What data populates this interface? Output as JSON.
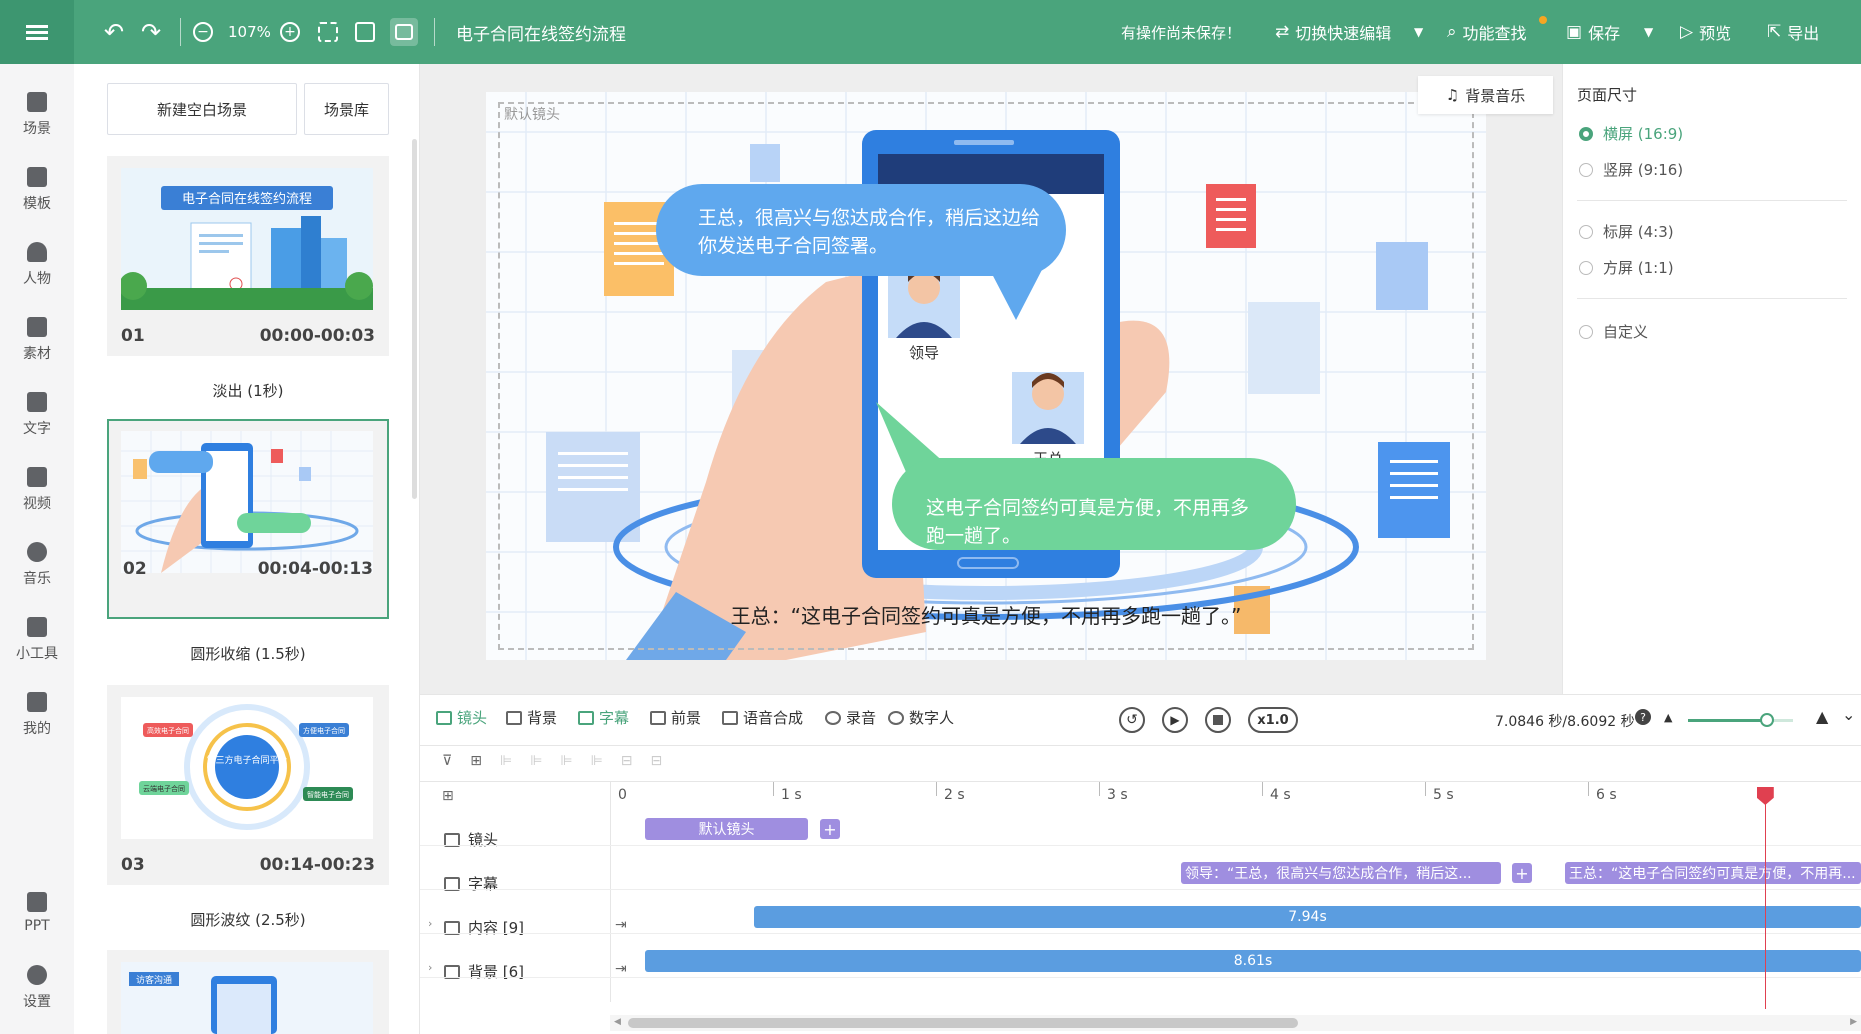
{
  "topbar": {
    "undo": "undo-icon",
    "redo": "redo-icon",
    "zoom": "107%",
    "doc_title": "电子合同在线签约流程",
    "unsaved": "有操作尚未保存！",
    "quick_edit": "切换快速编辑",
    "find": "功能查找",
    "save": "保存",
    "preview": "预览",
    "export": "导出"
  },
  "leftbar": [
    {
      "label": "场景"
    },
    {
      "label": "模板"
    },
    {
      "label": "人物"
    },
    {
      "label": "素材"
    },
    {
      "label": "文字"
    },
    {
      "label": "视频"
    },
    {
      "label": "音乐"
    },
    {
      "label": "小工具"
    },
    {
      "label": "我的"
    },
    {
      "label": "PPT"
    },
    {
      "label": "设置"
    }
  ],
  "scenes": {
    "new_blank": "新建空白场景",
    "library": "场景库",
    "items": [
      {
        "num": "01",
        "time": "00:00-00:03",
        "transition": "淡出 (1秒)",
        "thumb_title": "电子合同在线签约流程"
      },
      {
        "num": "02",
        "time": "00:04-00:13",
        "transition": "圆形收缩 (1.5秒)"
      },
      {
        "num": "03",
        "time": "00:14-00:23",
        "transition": "圆形波纹 (2.5秒)",
        "thumb_center": "第三方电子合同平台",
        "thumb_tags": [
          "高效电子合同",
          "方便电子合同",
          "云端电子合同",
          "智能电子合同"
        ]
      },
      {
        "num": "04",
        "thumb_title": "访客沟通"
      }
    ]
  },
  "canvas": {
    "bg_music": "背景音乐",
    "camera_label": "默认镜头",
    "bubble_top": "王总，很高兴与您达成合作，稍后这边给你发送电子合同签署。",
    "bubble_bottom": "这电子合同签约可真是方便，不用再多跑一趟了。",
    "leader_label": "领导",
    "wang_label": "王总",
    "subtitle": "王总：“这电子合同签约可真是方便，不用再多跑一趟了。”"
  },
  "right": {
    "title": "页面尺寸",
    "options": [
      "横屏 (16:9)",
      "竖屏 (9:16)",
      "标屏 (4:3)",
      "方屏 (1:1)",
      "自定义"
    ],
    "selected": "横屏 (16:9)"
  },
  "timeline": {
    "tabs": [
      "镜头",
      "背景",
      "字幕",
      "前景",
      "语音合成",
      "录音",
      "数字人"
    ],
    "speed": "x1.0",
    "time": "7.0846 秒/8.6092 秒",
    "ruler": [
      "0",
      "1 s",
      "2 s",
      "3 s",
      "4 s",
      "5 s",
      "6 s"
    ],
    "rows": {
      "camera": "镜头",
      "subtitle": "字幕",
      "content": "内容 [9]",
      "background": "背景 [6]"
    },
    "clips": {
      "camera": "默认镜头",
      "sub1": "领导：“王总，很高兴与您达成合作，稍后这...",
      "sub2": "王总：“这电子合同签约可真是方便，不用再...",
      "content": "7.94s",
      "background": "8.61s"
    },
    "zoom_fraction": 0.75,
    "playhead_seconds": 7.0846
  },
  "colors": {
    "accent": "#4aa47c",
    "clip_purple": "#9f8ee0",
    "clip_blue": "#5b9de0",
    "playhead": "#e04050"
  }
}
